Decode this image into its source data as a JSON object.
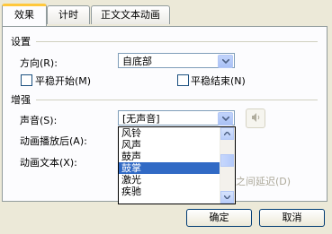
{
  "tabs": [
    {
      "label": "效果"
    },
    {
      "label": "计时"
    },
    {
      "label": "正文文本动画"
    }
  ],
  "settings": {
    "group_title": "设置",
    "direction_label": "方向(R):",
    "direction_value": "自底部",
    "smooth_start_label": "平稳开始(M)",
    "smooth_end_label": "平稳结束(N)"
  },
  "enhance": {
    "group_title": "增强",
    "sound_label": "声音(S):",
    "sound_value": "[无声音]",
    "after_anim_label": "动画播放后(A):",
    "anim_text_label": "动画文本(X):",
    "delay_between_text": "之间延迟(D)"
  },
  "sound_options": [
    {
      "label": "风铃",
      "selected": false
    },
    {
      "label": "风声",
      "selected": false
    },
    {
      "label": "鼓声",
      "selected": false
    },
    {
      "label": "鼓掌",
      "selected": true
    },
    {
      "label": "激光",
      "selected": false
    },
    {
      "label": "疾驰",
      "selected": false
    }
  ],
  "buttons": {
    "ok": "确定",
    "cancel": "取消"
  },
  "colors": {
    "background": "#ece9d8",
    "selection": "#316ac5",
    "accent_tab": "#ffc83c"
  }
}
